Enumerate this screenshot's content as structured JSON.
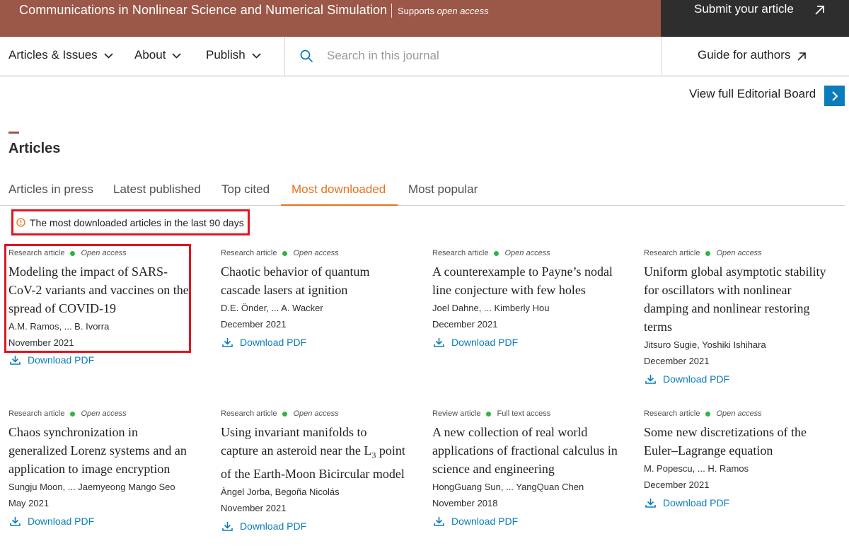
{
  "header": {
    "journal_title": "Communications in Nonlinear Science and Numerical Simulation",
    "open_access_prefix": "Supports ",
    "open_access_em": "open access",
    "submit_label": "Submit your article"
  },
  "nav": {
    "articles_issues": "Articles & Issues",
    "about": "About",
    "publish": "Publish",
    "search_placeholder": "Search in this journal",
    "guide": "Guide for authors"
  },
  "editorial": {
    "label": "View full Editorial Board"
  },
  "articles": {
    "title": "Articles",
    "tabs": [
      "Articles in press",
      "Latest published",
      "Top cited",
      "Most downloaded",
      "Most popular"
    ],
    "active_tab": "Most downloaded",
    "notice": "The most downloaded articles in the last 90 days",
    "download_label": "Download PDF",
    "items": [
      {
        "type": "Research article",
        "access": "Open access",
        "title": "Modeling the impact of SARS-CoV-2 variants and vaccines on the spread of COVID-19",
        "authors": "A.M. Ramos, ... B. Ivorra",
        "date": "November 2021"
      },
      {
        "type": "Research article",
        "access": "Open access",
        "title": "Chaotic behavior of quantum cascade lasers at ignition",
        "authors": "D.E. Önder, ... A. Wacker",
        "date": "December 2021"
      },
      {
        "type": "Research article",
        "access": "Open access",
        "title": "A counterexample to Payne’s nodal line conjecture with few holes",
        "authors": "Joel Dahne, ... Kimberly Hou",
        "date": "December 2021"
      },
      {
        "type": "Research article",
        "access": "Open access",
        "title": "Uniform global asymptotic stability for oscillators with nonlinear damping and nonlinear restoring terms",
        "authors": "Jitsuro Sugie, Yoshiki Ishihara",
        "date": "December 2021"
      },
      {
        "type": "Research article",
        "access": "Open access",
        "title": "Chaos synchronization in generalized Lorenz systems and an application to image encryption",
        "authors": "Sungju Moon, ... Jaemyeong Mango Seo",
        "date": "May 2021"
      },
      {
        "type": "Research article",
        "access": "Open access",
        "title_before_sub": "Using invariant manifolds to capture an asteroid near the L",
        "title_sub": "3",
        "title_after_sub": " point of the Earth-Moon Bicircular model",
        "authors": "Àngel Jorba, Begoña Nicolás",
        "date": "November 2021"
      },
      {
        "type": "Review article",
        "access": "Full text access",
        "title": "A new collection of real world applications of fractional calculus in science and engineering",
        "authors": "HongGuang Sun, ... YangQuan Chen",
        "date": "November 2018"
      },
      {
        "type": "Research article",
        "access": "Open access",
        "title": "Some new discretizations of the Euler–Lagrange equation",
        "authors": "M. Popescu, ... H. Ramos",
        "date": "December 2021"
      }
    ]
  },
  "colors": {
    "brand": "#9b5748",
    "dark": "#2e2e2e",
    "accent": "#e9711c",
    "link": "#0c7dbb",
    "open_access_dot": "#2fb24a",
    "highlight": "#e3141e"
  }
}
